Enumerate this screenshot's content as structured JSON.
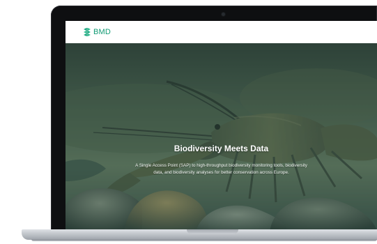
{
  "site": {
    "brand": "BMD",
    "brand_color": "#0f9a73",
    "logo_icon": "leaf-grid-icon"
  },
  "hero": {
    "title": "Biodiversity Meets Data",
    "body": "A Single Access Point (SAP) to high-throughput biodiversity monitoring tools, biodiversity data, and biodiversity analyses for better conservation across Europe.",
    "image_subject": "crayfish-on-riverbed-image"
  },
  "device": {
    "frame": "laptop"
  }
}
